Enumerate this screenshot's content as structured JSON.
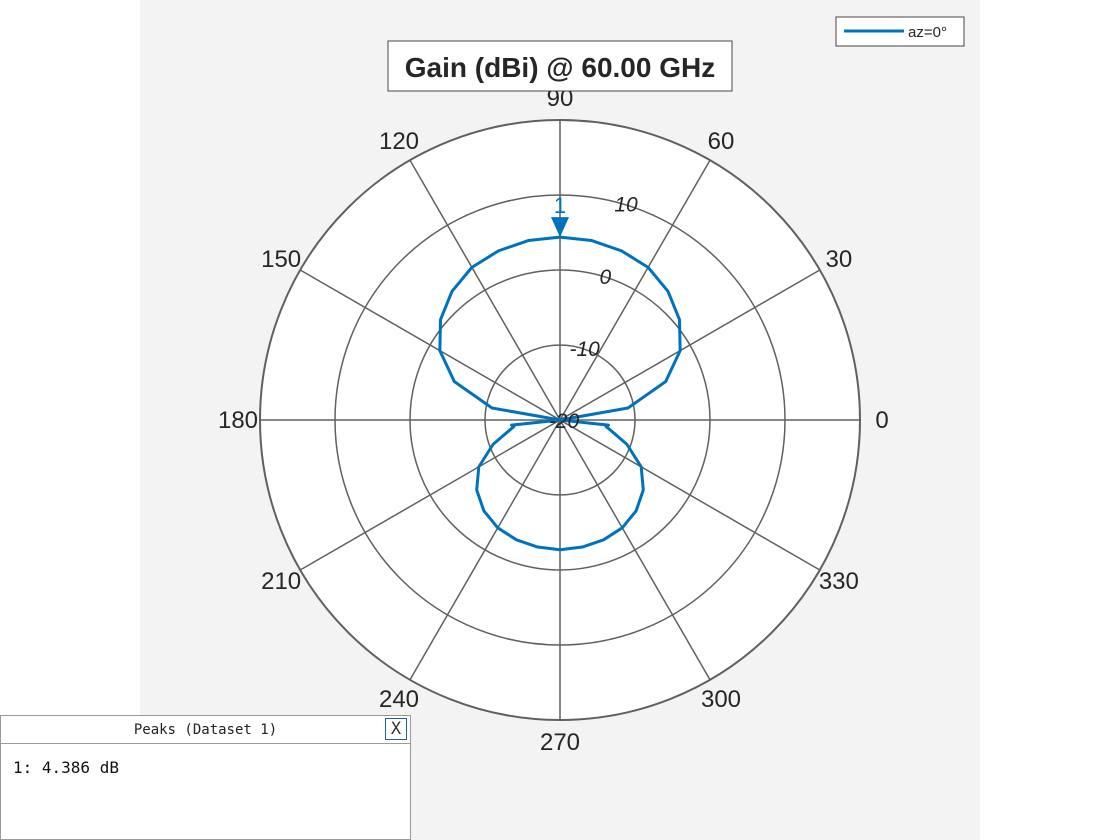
{
  "chart_data": {
    "type": "polar",
    "title": "Gain (dBi) @ 60.00 GHz",
    "angle_unit": "degrees",
    "angle_ticks": [
      "0",
      "30",
      "60",
      "90",
      "120",
      "150",
      "180",
      "210",
      "240",
      "270",
      "300",
      "330"
    ],
    "radial_ticks": [
      "-20",
      "-10",
      "0",
      "10"
    ],
    "radial_range_db": [
      -20,
      20
    ],
    "grid": true,
    "legend": {
      "placement": "top-right",
      "entries": [
        "az=0°"
      ]
    },
    "series": [
      {
        "name": "az=0°",
        "color": "#0072BD",
        "angles_deg": [
          0,
          10,
          20,
          30,
          40,
          50,
          60,
          70,
          80,
          90,
          100,
          110,
          120,
          130,
          140,
          150,
          160,
          170,
          180,
          186,
          188,
          192,
          200,
          210,
          220,
          230,
          240,
          250,
          260,
          270,
          280,
          290,
          300,
          310,
          320,
          330,
          340,
          348,
          352,
          354,
          360
        ],
        "gain_db": [
          -20,
          -10.8,
          -5.0,
          -1.5,
          0.8,
          2.4,
          3.5,
          4.0,
          4.3,
          4.386,
          4.3,
          4.0,
          3.5,
          2.4,
          0.8,
          -1.5,
          -5.0,
          -10.8,
          -20,
          -13.5,
          -13.8,
          -13.0,
          -10.5,
          -7.5,
          -5.5,
          -4.2,
          -3.4,
          -3.0,
          -2.8,
          -2.7,
          -2.8,
          -3.0,
          -3.4,
          -4.2,
          -5.5,
          -7.5,
          -10.5,
          -13.0,
          -13.8,
          -13.5,
          -20
        ]
      }
    ],
    "peak_marker": {
      "label": "1",
      "angle_deg": 90,
      "value_db": 4.386
    }
  },
  "peaks_panel": {
    "title": "Peaks (Dataset 1)",
    "close_label": "X",
    "entry": "1: 4.386 dB"
  }
}
